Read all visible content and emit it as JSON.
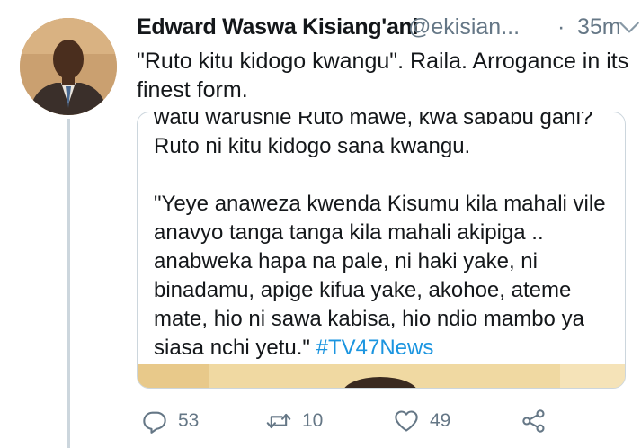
{
  "tweet": {
    "author_name": "Edward Waswa Kisiang'ani",
    "author_handle": "@ekisian...",
    "separator": "·",
    "timestamp": "35m",
    "text": "\"Ruto kitu kidogo kwangu\". Raila. Arrogance in its finest form."
  },
  "quoted": {
    "partial_line": "watu warushie Ruto mawe, kwa sababu gani?",
    "line_2": "Ruto ni kitu kidogo sana kwangu.",
    "paragraph_2": "\"Yeye anaweza kwenda Kisumu kila mahali vile anavyo tanga tanga kila mahali akipiga .. anabweka hapa na pale, ni haki yake, ni binadamu, apige kifua yake, akohoe, ateme mate,  hio ni sawa kabisa, hio ndio  mambo ya siasa nchi yetu.\"",
    "hashtag": "#TV47News"
  },
  "actions": {
    "reply_count": "53",
    "retweet_count": "10",
    "like_count": "49"
  },
  "icons": {
    "reply": "reply-icon",
    "retweet": "retweet-icon",
    "like": "heart-icon",
    "share": "share-icon",
    "caret": "chevron-down-icon"
  },
  "colors": {
    "text": "#14171a",
    "secondary": "#657786",
    "link": "#1b95e0",
    "border": "#ccd6dd"
  }
}
